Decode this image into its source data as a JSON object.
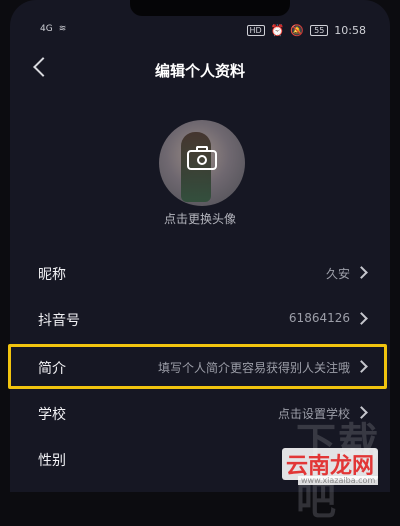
{
  "status": {
    "signal_label": "4G",
    "wifi_label": "≋",
    "hd_label": "HD",
    "alarm_icon": "alarm-icon",
    "mute_icon": "mute-icon",
    "battery": "55",
    "time": "10:58"
  },
  "header": {
    "title": "编辑个人资料"
  },
  "avatar": {
    "label": "点击更换头像"
  },
  "fields": [
    {
      "label": "昵称",
      "value": "久安"
    },
    {
      "label": "抖音号",
      "value": "61864126"
    },
    {
      "label": "简介",
      "value": "填写个人简介更容易获得别人关注哦"
    },
    {
      "label": "学校",
      "value": "点击设置学校"
    },
    {
      "label": "性别",
      "value": ""
    }
  ],
  "watermark": {
    "brand_top": "下载吧",
    "brand_main": "云南龙网",
    "url": "www.xiazaiba.com"
  },
  "colors": {
    "background": "#161723",
    "highlight": "#f1c40f",
    "text_primary": "#f2f2f5",
    "text_secondary": "#9c9ea8"
  }
}
